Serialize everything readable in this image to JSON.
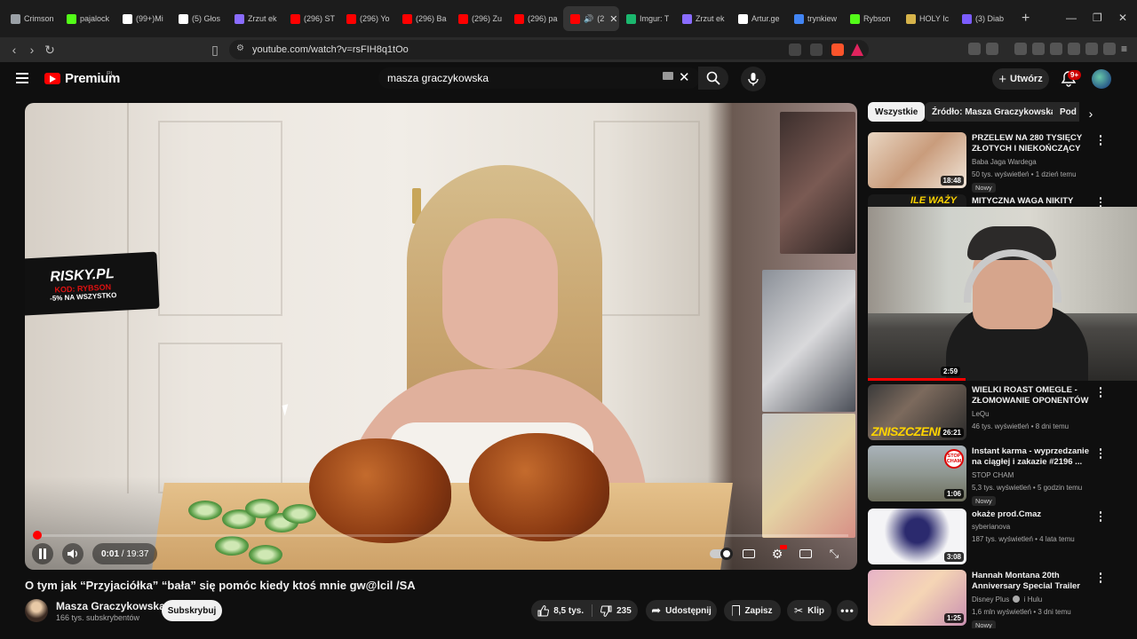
{
  "browser": {
    "tabs": [
      {
        "title": "Crimson",
        "color": "#9aa0a6",
        "active": false
      },
      {
        "title": "pajalock",
        "color": "#53fc18",
        "active": false
      },
      {
        "title": "(99+)Mi",
        "color": "#ffffff",
        "active": false
      },
      {
        "title": "(5) Głos",
        "color": "#ffffff",
        "active": false
      },
      {
        "title": "Zrzut ek",
        "color": "#8a6cff",
        "active": false
      },
      {
        "title": "(296) ST",
        "color": "#ff0000",
        "active": false
      },
      {
        "title": "(296) Yo",
        "color": "#ff0000",
        "active": false
      },
      {
        "title": "(296) Ba",
        "color": "#ff0000",
        "active": false
      },
      {
        "title": "(296) Zu",
        "color": "#ff0000",
        "active": false
      },
      {
        "title": "(296) pa",
        "color": "#ff0000",
        "active": false
      },
      {
        "title": "(2",
        "color": "#ff0000",
        "active": true
      },
      {
        "title": "Imgur: T",
        "color": "#1bb76e",
        "active": false
      },
      {
        "title": "Zrzut ek",
        "color": "#8a6cff",
        "active": false
      },
      {
        "title": "Artur.ge",
        "color": "#ffffff",
        "active": false
      },
      {
        "title": "trynkiew",
        "color": "#4285f4",
        "active": false
      },
      {
        "title": "Rybson",
        "color": "#53fc18",
        "active": false
      },
      {
        "title": "HOLY Ic",
        "color": "#d6b34a",
        "active": false
      },
      {
        "title": "(3) Diab",
        "color": "#7b5cff",
        "active": false
      }
    ],
    "new_tab_glyph": "+",
    "url": "youtube.com/watch?v=rsFIH8q1tOo"
  },
  "header": {
    "logo_text": "Premium",
    "logo_superscript": "PL",
    "search_query": "masza graczykowska",
    "create_label": "Utwórz",
    "notifications_badge": "9+"
  },
  "player": {
    "overlay": {
      "line1": "RISKY.PL",
      "line2": "KOD: RYBSON",
      "line3": "-5% NA WSZYSTKO"
    },
    "current_time": "0:01",
    "time_separator": " / ",
    "duration": "19:37",
    "progress_fraction": 0.001,
    "brand_color": "#ff0000"
  },
  "video": {
    "title": "O tym jak “Przyjaciółka” “bała” się pomóc kiedy ktoś mnie gw@lcil /SA",
    "channel_name": "Masza Graczykowska",
    "subscribers": "166 tys. subskrybentów",
    "subscribe_label": "Subskrybuj",
    "likes": "8,5 tys.",
    "dislikes": "235",
    "share_label": "Udostępnij",
    "save_label": "Zapisz",
    "clip_label": "Klip"
  },
  "sidebar": {
    "chips": [
      "Wszystkie",
      "Źródło: Masza Graczykowska",
      "Pod"
    ],
    "recommendations": [
      {
        "title": "PRZELEW NA 280 TYSIĘCY ZŁOTYCH I NIEKOŃCZĄCY SIĘ...",
        "channel": "Baba Jaga Wardega",
        "meta": "50 tys. wyświetleń • 1 dzień temu",
        "badge": "Nowy",
        "duration": "18:48"
      },
      {
        "title": "MITYCZNA WAGA NIKITY",
        "thumb_text": "ILE WAŻY",
        "channel": "",
        "meta": "",
        "badge": "",
        "duration": "2:59"
      },
      {
        "title": "WIELKI ROAST OMEGLE - ZŁOMOWANIE OPONENTÓW ...",
        "thumb_text": "ZNISZCZENI",
        "channel": "LeQu",
        "meta": "46 tys. wyświetleń • 8 dni temu",
        "badge": "",
        "duration": "26:21"
      },
      {
        "title": "Instant karma - wyprzedzanie na ciągłej i zakazie #2196 ...",
        "thumb_text": "STOP CHAM",
        "channel": "STOP CHAM",
        "meta": "5,3 tys. wyświetleń • 5 godzin temu",
        "badge": "Nowy",
        "duration": "1:06"
      },
      {
        "title": "okaże prod.Cmaz",
        "channel": "syberianova",
        "meta": "187 tys. wyświetleń • 4 lata temu",
        "badge": "",
        "duration": "3:08"
      },
      {
        "title": "Hannah Montana 20th Anniversary Special Trailer",
        "channel": "Disney Plus",
        "channel_suffix": "i Hulu",
        "meta": "1,6 mln wyświetleń • 3 dni temu",
        "badge": "Nowy",
        "duration": "1:25"
      }
    ]
  }
}
